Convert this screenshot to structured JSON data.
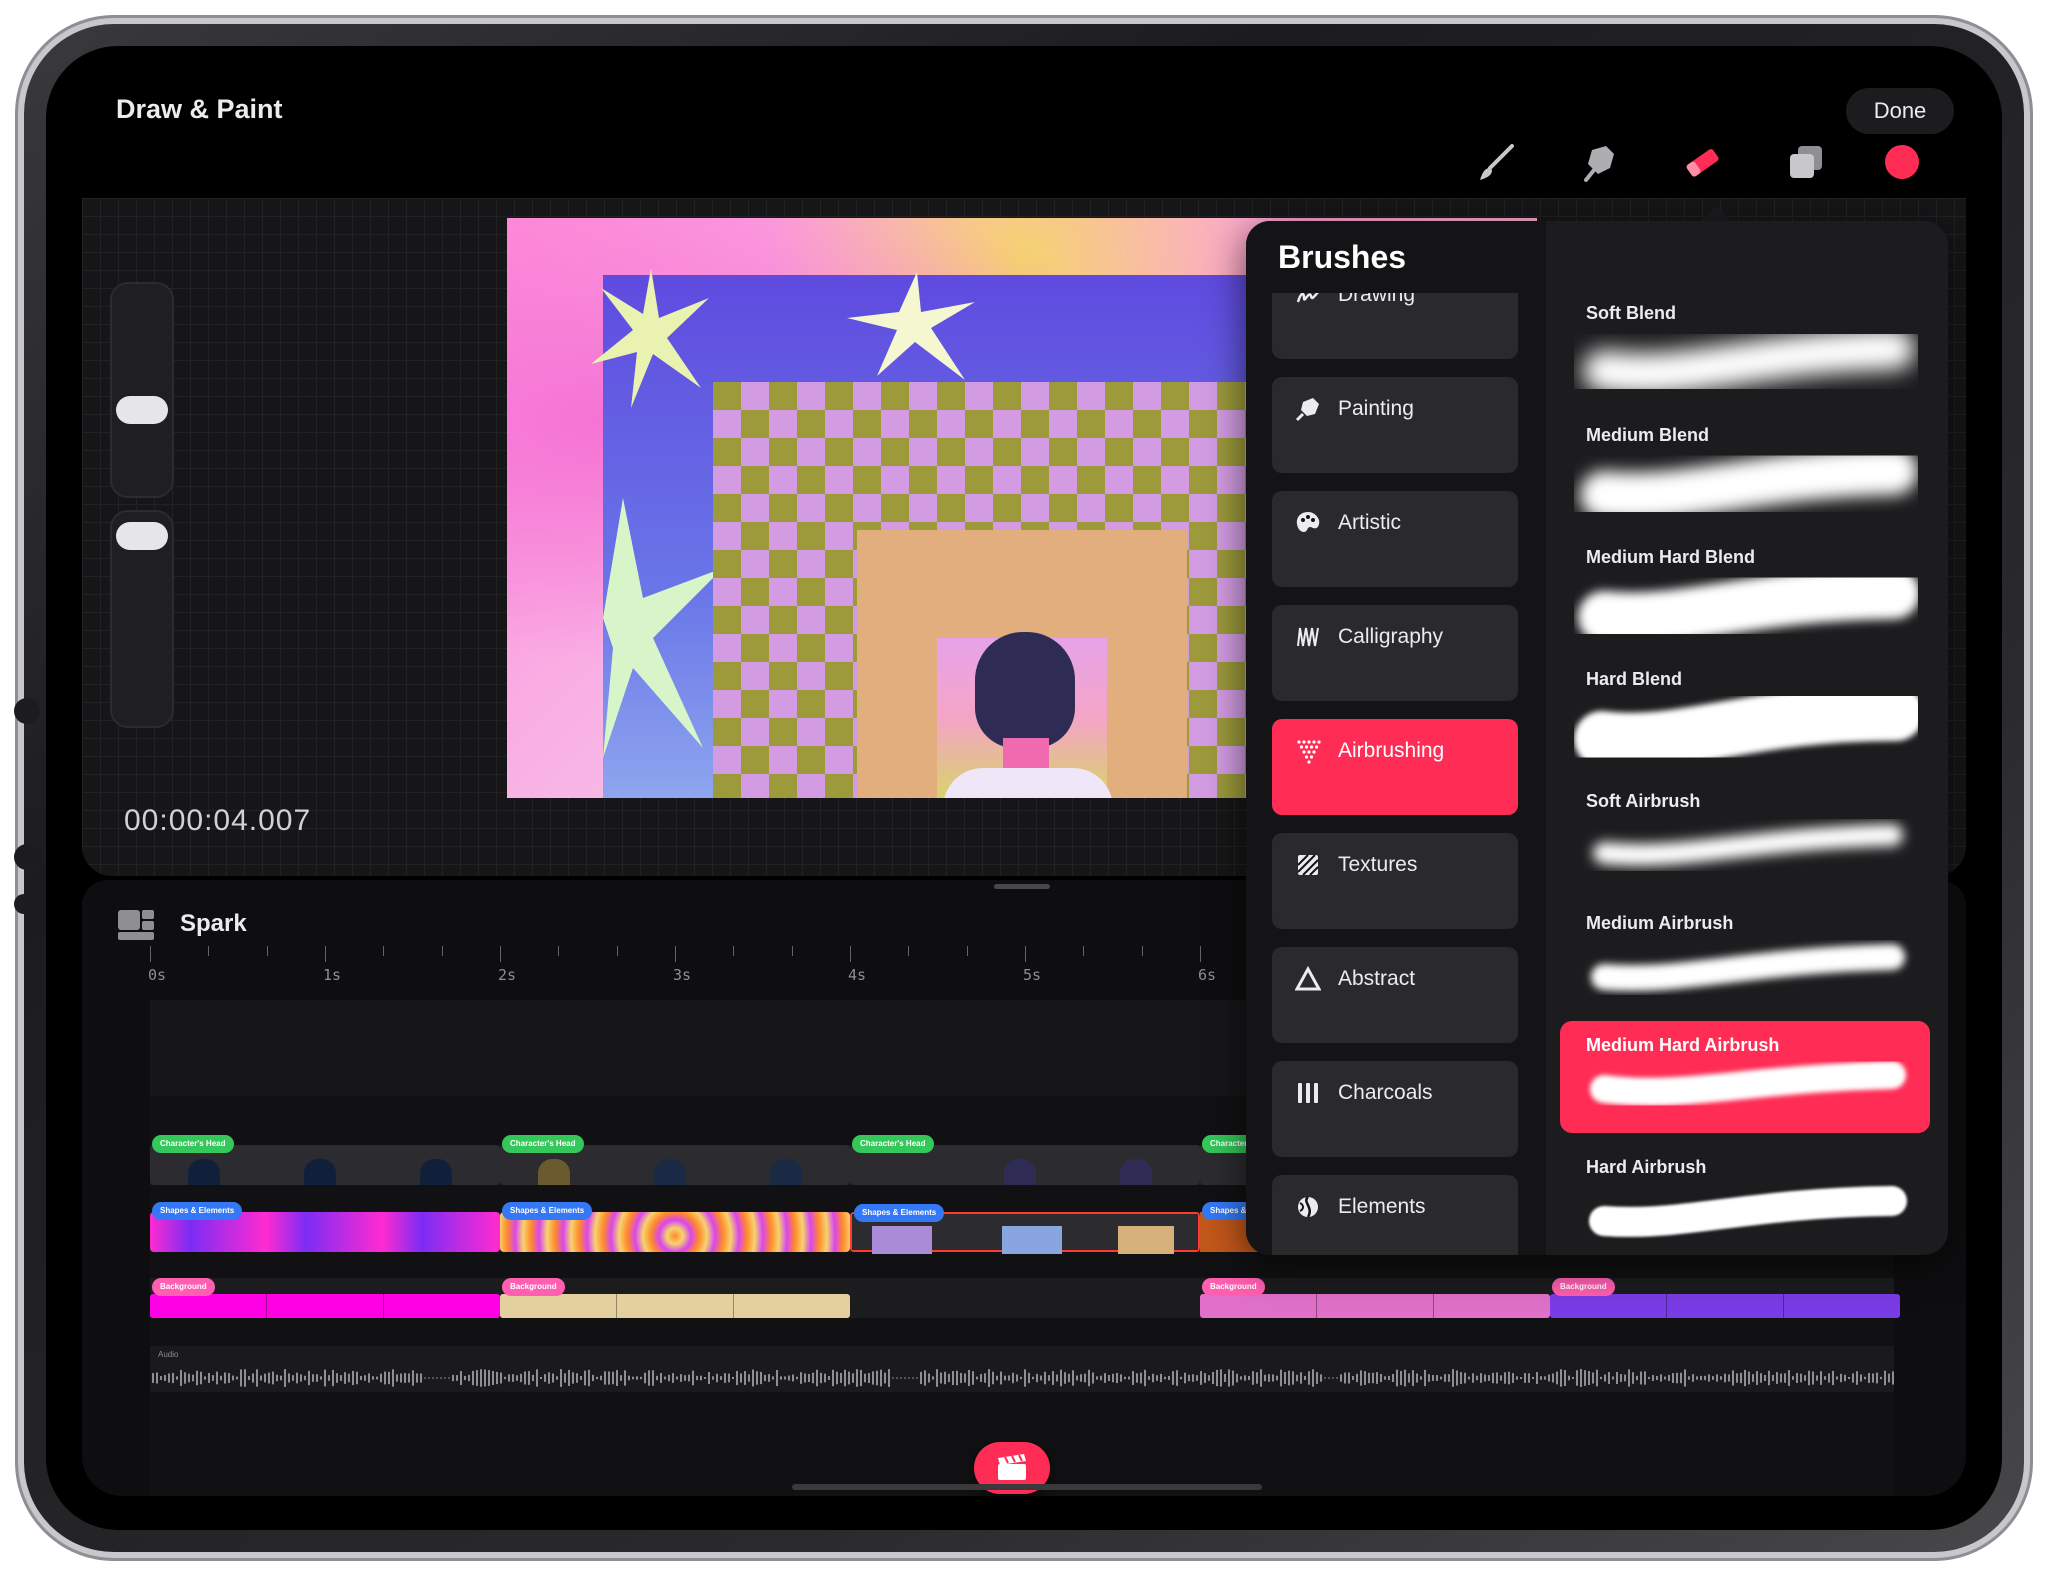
{
  "app": {
    "title": "Draw & Paint",
    "done_label": "Done"
  },
  "toolbar": {
    "tools": [
      {
        "name": "brush-icon",
        "active": false
      },
      {
        "name": "smudge-icon",
        "active": false
      },
      {
        "name": "eraser-icon",
        "active": true
      },
      {
        "name": "layers-icon",
        "active": false
      },
      {
        "name": "color-icon",
        "active": false
      }
    ],
    "accent_color": "#ff2d55",
    "active_color": "#ff2d55"
  },
  "canvas": {
    "timecode": "00:00:04.007"
  },
  "timeline": {
    "project_name": "Spark",
    "ruler_labels": [
      "0s",
      "1s",
      "2s",
      "3s",
      "4s",
      "5s",
      "6s"
    ],
    "clip_labels": {
      "character": "Character's Head",
      "shapes": "Shapes & Elements",
      "background": "Background",
      "audio": "Audio"
    }
  },
  "brushes": {
    "title": "Brushes",
    "categories": [
      {
        "label": "Drawing",
        "icon": "drawing-icon"
      },
      {
        "label": "Painting",
        "icon": "painting-icon"
      },
      {
        "label": "Artistic",
        "icon": "palette-icon"
      },
      {
        "label": "Calligraphy",
        "icon": "calligraphy-icon"
      },
      {
        "label": "Airbrushing",
        "icon": "airbrush-icon",
        "selected": true
      },
      {
        "label": "Textures",
        "icon": "textures-icon"
      },
      {
        "label": "Abstract",
        "icon": "abstract-icon"
      },
      {
        "label": "Charcoals",
        "icon": "charcoal-icon"
      },
      {
        "label": "Elements",
        "icon": "elements-icon"
      }
    ],
    "items": [
      {
        "name": "Soft Blend"
      },
      {
        "name": "Medium Blend"
      },
      {
        "name": "Medium Hard Blend"
      },
      {
        "name": "Hard Blend"
      },
      {
        "name": "Soft Airbrush"
      },
      {
        "name": "Medium Airbrush"
      },
      {
        "name": "Medium Hard Airbrush",
        "selected": true
      },
      {
        "name": "Hard Airbrush"
      }
    ]
  }
}
